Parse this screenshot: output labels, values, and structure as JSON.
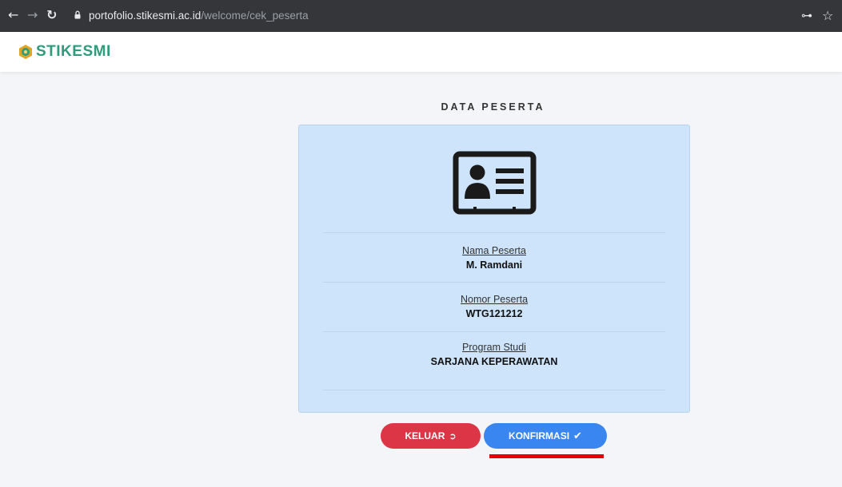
{
  "browser": {
    "url_host": "portofolio.stikesmi.ac.id",
    "url_path": "/welcome/cek_peserta"
  },
  "header": {
    "logo_text": "STIKESMI"
  },
  "main": {
    "title": "DATA PESERTA",
    "fields": [
      {
        "label": "Nama Peserta",
        "value": "M. Ramdani"
      },
      {
        "label": "Nomor Peserta",
        "value": "WTG121212"
      },
      {
        "label": "Program Studi",
        "value": "SARJANA KEPERAWATAN"
      }
    ]
  },
  "buttons": {
    "keluar": "KELUAR",
    "konfirmasi": "KONFIRMASI"
  },
  "icons": [
    "back-icon",
    "forward-icon",
    "reload-icon",
    "lock-icon",
    "key-icon",
    "star-icon",
    "logo-icon",
    "id-card-icon",
    "sign-out-icon",
    "check-icon"
  ],
  "colors": {
    "card_bg": "#cde4fb",
    "keluar_btn": "#dc3545",
    "konfirmasi_btn": "#3a86f0",
    "highlight": "#e60000"
  }
}
